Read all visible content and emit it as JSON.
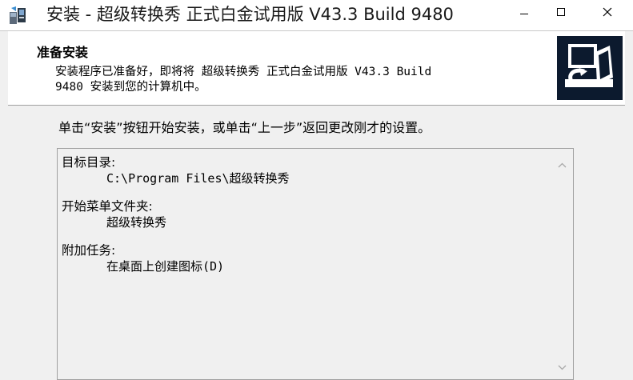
{
  "window": {
    "title": "安装 - 超级转换秀 正式白金试用版 V43.3 Build 9480",
    "icon": "installer-icon",
    "controls": [
      "minimize-icon",
      "maximize-icon",
      "close-icon"
    ]
  },
  "header": {
    "title": "准备安装",
    "description": "安装程序已准备好，即将将 超级转换秀 正式白金试用版 V43.3 Build\n9480 安装到您的计算机中。",
    "logo_icon": "computer-install-icon"
  },
  "main": {
    "instruction": "单击“安装”按钮开始安装，或单击“上一步”返回更改刚才的设置。"
  },
  "memo": {
    "sections": [
      {
        "heading": "目标目录:",
        "value": "C:\\Program Files\\超级转换秀"
      },
      {
        "heading": "开始菜单文件夹:",
        "value": "超级转换秀"
      },
      {
        "heading": "附加任务:",
        "value": "在桌面上创建图标(D)"
      }
    ],
    "scroll_icons": [
      "scroll-up-icon",
      "scroll-down-icon"
    ]
  }
}
